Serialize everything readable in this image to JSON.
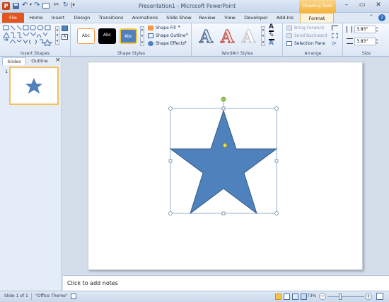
{
  "window": {
    "title": "Presentation1 - Microsoft PowerPoint",
    "context_tab_label": "Drawing Tools",
    "qat": {
      "undo_glyph": "↶",
      "redo_glyph": "↷",
      "customize_glyph": "|▾"
    },
    "controls": {
      "minimize": "–",
      "restore": "▭",
      "close": "✕"
    }
  },
  "ribbon_tabs": [
    {
      "label": "File"
    },
    {
      "label": "Home"
    },
    {
      "label": "Insert"
    },
    {
      "label": "Design"
    },
    {
      "label": "Transitions"
    },
    {
      "label": "Animations"
    },
    {
      "label": "Slide Show"
    },
    {
      "label": "Review"
    },
    {
      "label": "View"
    },
    {
      "label": "Developer"
    },
    {
      "label": "Add-Ins"
    },
    {
      "label": "Format"
    }
  ],
  "ribbon_extras": {
    "help": "?",
    "collapse": "^"
  },
  "groups": {
    "insert_shapes": {
      "label": "Insert Shapes"
    },
    "shape_styles": {
      "label": "Shape Styles",
      "styles": [
        {
          "label": "Abc"
        },
        {
          "label": "Abc"
        },
        {
          "label": "Abc"
        }
      ],
      "fill": "Shape Fill",
      "outline": "Shape Outline",
      "effects": "Shape Effects"
    },
    "wordart_styles": {
      "label": "WordArt Styles",
      "sample": "A"
    },
    "arrange": {
      "label": "Arrange",
      "bring_forward": "Bring Forward",
      "send_backward": "Send Backward",
      "selection_pane": "Selection Pane"
    },
    "size": {
      "label": "Size",
      "height": "3.83\"",
      "width": "3.83\""
    }
  },
  "panel": {
    "tab_slides": "Slides",
    "tab_outline": "Outline",
    "close": "×",
    "slide_number": "1"
  },
  "notes": {
    "placeholder": "Click to add notes"
  },
  "status": {
    "slide": "Slide 1 of 1",
    "theme": "\"Office Theme\"",
    "zoom": "73%",
    "zoom_level": 0.73,
    "zoom_minus": "−",
    "zoom_plus": "+"
  },
  "colors": {
    "star_fill": "#4f81bd",
    "star_stroke": "#385d8a",
    "file_tab": "#e1551f",
    "context_tab": "#f3b23b"
  }
}
